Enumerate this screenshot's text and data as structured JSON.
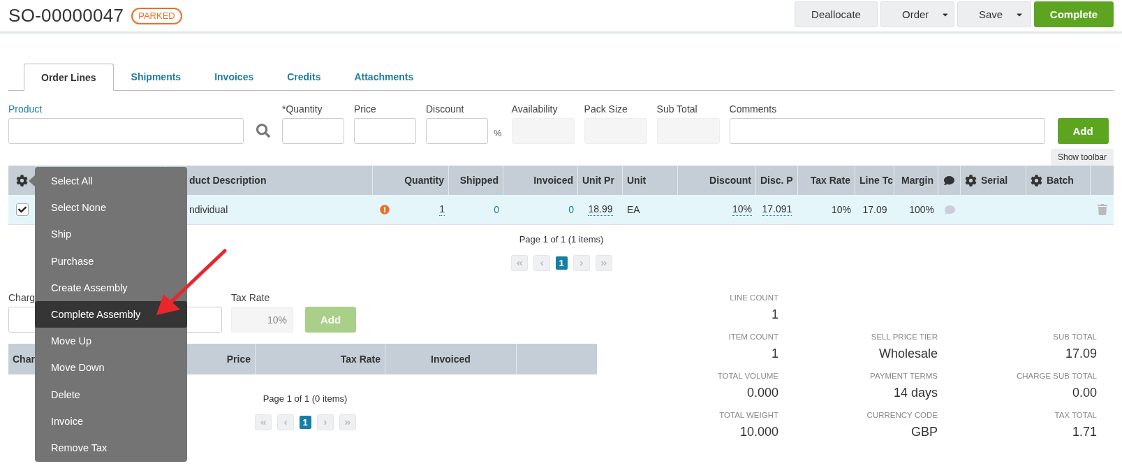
{
  "header": {
    "title": "SO-00000047",
    "status": "PARKED",
    "buttons": [
      {
        "label": "Deallocate",
        "kind": "plain"
      },
      {
        "label": "Order",
        "kind": "dropdown"
      },
      {
        "label": "Save",
        "kind": "dropdown"
      },
      {
        "label": "Complete",
        "kind": "primary"
      }
    ]
  },
  "tabs": [
    {
      "label": "Order Lines",
      "selected": true
    },
    {
      "label": "Shipments",
      "selected": false
    },
    {
      "label": "Invoices",
      "selected": false
    },
    {
      "label": "Credits",
      "selected": false
    },
    {
      "label": "Attachments",
      "selected": false
    }
  ],
  "line_form": {
    "fields": [
      {
        "label": "Product",
        "kind": "search"
      },
      {
        "label": "*Quantity",
        "kind": "input"
      },
      {
        "label": "Price",
        "kind": "input"
      },
      {
        "label": "Discount",
        "kind": "input",
        "suffix": "%"
      },
      {
        "label": "Availability",
        "kind": "readonly"
      },
      {
        "label": "Pack Size",
        "kind": "readonly"
      },
      {
        "label": "Sub Total",
        "kind": "readonly"
      },
      {
        "label": "Comments",
        "kind": "wide"
      }
    ],
    "add_button": "Add",
    "show_toolbar": "Show toolbar"
  },
  "lines_table": {
    "columns": [
      {
        "kind": "settings"
      },
      {
        "kind": "text",
        "label": "duct Description"
      },
      {
        "kind": "text",
        "label": "Quantity"
      },
      {
        "kind": "text",
        "label": "Shipped"
      },
      {
        "kind": "text",
        "label": "Invoiced"
      },
      {
        "kind": "text",
        "label": "Unit Pr"
      },
      {
        "kind": "text",
        "label": "Unit"
      },
      {
        "kind": "text",
        "label": "Discount"
      },
      {
        "kind": "text",
        "label": "Disc. P"
      },
      {
        "kind": "text",
        "label": "Tax Rate"
      },
      {
        "kind": "text",
        "label": "Line Tc"
      },
      {
        "kind": "text",
        "label": "Margin"
      },
      {
        "kind": "comment"
      },
      {
        "kind": "gear-text",
        "label": "Serial"
      },
      {
        "kind": "gear-text",
        "label": "Batch"
      },
      {
        "kind": "blank"
      }
    ],
    "rows": [
      {
        "cells": [
          {
            "kind": "checkbox",
            "checked": true
          },
          {
            "kind": "text",
            "text": "ndividual"
          },
          {
            "kind": "edit",
            "text": "1",
            "warning": true
          },
          {
            "kind": "link",
            "text": "0"
          },
          {
            "kind": "link",
            "text": "0"
          },
          {
            "kind": "edit",
            "text": "18.99"
          },
          {
            "kind": "text",
            "text": "EA"
          },
          {
            "kind": "edit",
            "text": "10%"
          },
          {
            "kind": "edit",
            "text": "17.091"
          },
          {
            "kind": "text",
            "text": "10%"
          },
          {
            "kind": "text",
            "text": "17.09"
          },
          {
            "kind": "text",
            "text": "100%"
          },
          {
            "kind": "comment"
          },
          {
            "kind": "blank"
          },
          {
            "kind": "blank"
          },
          {
            "kind": "delete"
          }
        ]
      }
    ],
    "pager": {
      "summary": "Page 1 of 1 (1 items)",
      "pages": [
        {
          "label": "1",
          "selected": true
        }
      ]
    }
  },
  "context_menu": {
    "items": [
      {
        "label": "Select All",
        "selected": false
      },
      {
        "label": "Select None",
        "selected": false
      },
      {
        "label": "Ship",
        "selected": false
      },
      {
        "label": "Purchase",
        "selected": false
      },
      {
        "label": "Create Assembly",
        "selected": false
      },
      {
        "label": "Complete Assembly",
        "selected": true
      },
      {
        "label": "Move Up",
        "selected": false
      },
      {
        "label": "Move Down",
        "selected": false
      },
      {
        "label": "Delete",
        "selected": false
      },
      {
        "label": "Invoice",
        "selected": false
      },
      {
        "label": "Remove Tax",
        "selected": false
      }
    ]
  },
  "charges": {
    "fields": [
      {
        "label": "Charg",
        "kind": "input"
      },
      {
        "label": "Tax Rate",
        "kind": "readonly",
        "value": "10%"
      }
    ],
    "add_button": {
      "label": "Add",
      "disabled": true
    },
    "columns": [
      {
        "label": "Char"
      },
      {
        "label": "Price"
      },
      {
        "label": "Tax Rate"
      },
      {
        "label": "Invoiced"
      }
    ],
    "pager": {
      "summary": "Page 1 of 1 (0 items)",
      "pages": [
        {
          "label": "1",
          "selected": true
        }
      ]
    }
  },
  "summary": {
    "rows": [
      [
        {
          "label": "LINE COUNT",
          "value": "1"
        }
      ],
      [
        {
          "label": "ITEM COUNT",
          "value": "1"
        },
        {
          "label": "SELL PRICE TIER",
          "value": "Wholesale"
        },
        {
          "label": "SUB TOTAL",
          "value": "17.09"
        }
      ],
      [
        {
          "label": "TOTAL VOLUME",
          "value": "0.000"
        },
        {
          "label": "PAYMENT TERMS",
          "value": "14 days"
        },
        {
          "label": "CHARGE SUB TOTAL",
          "value": "0.00"
        }
      ],
      [
        {
          "label": "TOTAL WEIGHT",
          "value": "10.000"
        },
        {
          "label": "CURRENCY CODE",
          "value": "GBP"
        },
        {
          "label": "TAX TOTAL",
          "value": "1.71"
        }
      ]
    ]
  }
}
